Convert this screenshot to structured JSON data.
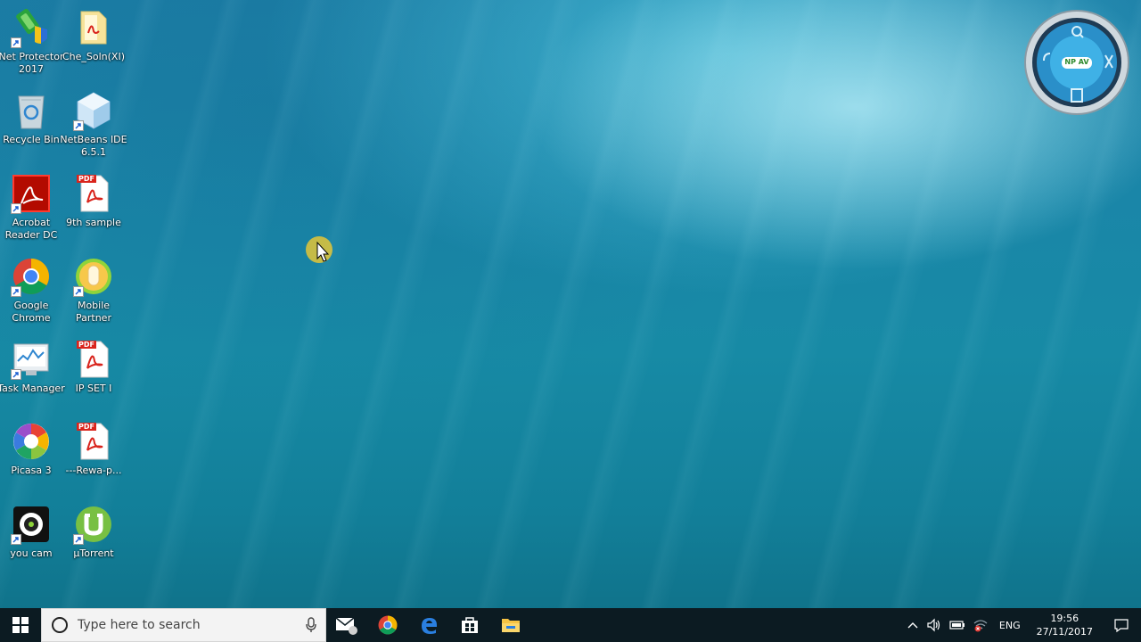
{
  "desktop": {
    "icons": [
      {
        "label": "Net Protector 2017",
        "icon": "net-protector-icon"
      },
      {
        "label": "Che_Soln(XI)",
        "icon": "pdf-folder-icon"
      },
      {
        "label": "Recycle Bin",
        "icon": "recycle-bin-icon"
      },
      {
        "label": "NetBeans IDE 6.5.1",
        "icon": "netbeans-icon"
      },
      {
        "label": "Acrobat Reader DC",
        "icon": "acrobat-icon"
      },
      {
        "label": "9th sample",
        "icon": "pdf-icon"
      },
      {
        "label": "Google Chrome",
        "icon": "chrome-icon"
      },
      {
        "label": "Mobile Partner",
        "icon": "mobile-partner-icon"
      },
      {
        "label": "Task Manager",
        "icon": "task-manager-icon"
      },
      {
        "label": "IP SET I",
        "icon": "pdf-icon"
      },
      {
        "label": "Picasa 3",
        "icon": "picasa-icon"
      },
      {
        "label": "---Rewa-p...",
        "icon": "pdf-icon"
      },
      {
        "label": "you cam",
        "icon": "youcam-icon"
      },
      {
        "label": "µTorrent",
        "icon": "utorrent-icon"
      }
    ],
    "pdf_badge": "PDF"
  },
  "widget": {
    "badge": "NP AV"
  },
  "taskbar": {
    "search_placeholder": "Type here to search",
    "apps": [
      "mail-icon",
      "chrome-icon",
      "edge-icon",
      "store-icon",
      "file-explorer-icon"
    ],
    "tray": {
      "language": "ENG",
      "time": "19:56",
      "date": "27/11/2017"
    }
  },
  "colors": {
    "taskbar_bg": "#0c1b22",
    "accent": "#1a86a8"
  }
}
